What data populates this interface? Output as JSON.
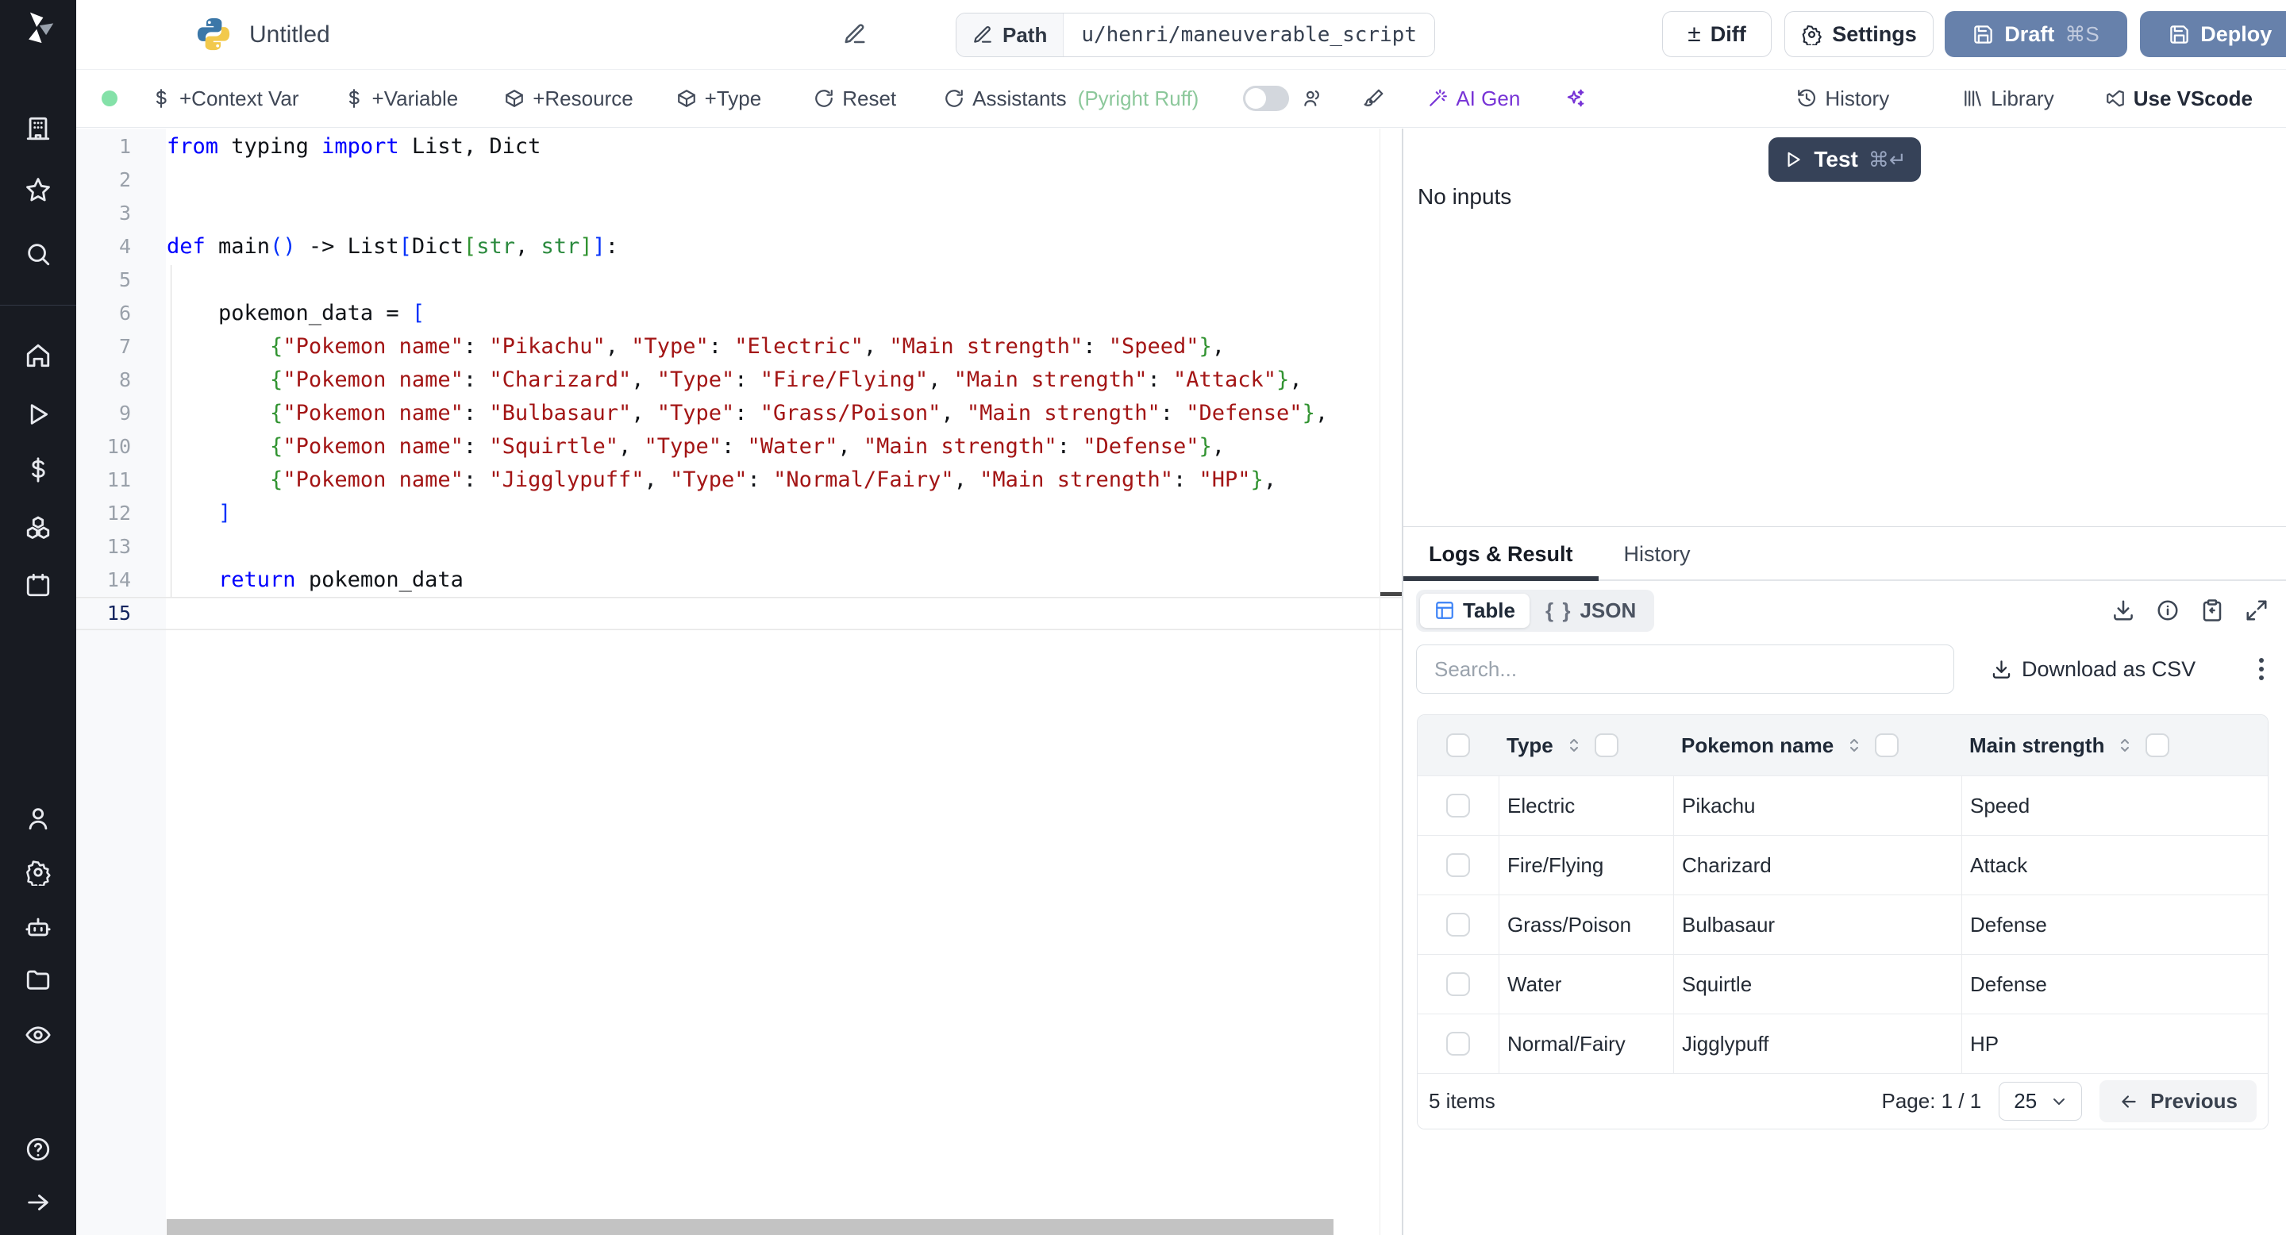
{
  "colors": {
    "slate_button": "#6781ab",
    "navy_button": "#364258",
    "ai_purple": "#7733d6",
    "status_green": "#84e1a8",
    "keyword_blue": "#0000ff",
    "string_red": "#a31515",
    "bracket_blue": "#0431fa",
    "bracket_green": "#319331",
    "type_green": "#2b8a3e"
  },
  "sidebar": {
    "icons": [
      "workspace",
      "favorites",
      "search",
      "home",
      "runs",
      "variables",
      "resources",
      "schedules",
      "users",
      "settings",
      "workers",
      "folders",
      "audit-logs",
      "help",
      "expand"
    ]
  },
  "topbar": {
    "title": "Untitled",
    "path_label": "Path",
    "path_value": "u/henri/maneuverable_script",
    "diff": "Diff",
    "diff_glyph": "±",
    "settings": "Settings",
    "draft": "Draft",
    "draft_shortcut": "⌘S",
    "deploy": "Deploy"
  },
  "toolbar": {
    "context_var": "+Context Var",
    "variable": "+Variable",
    "resource": "+Resource",
    "type": "+Type",
    "reset": "Reset",
    "assistants": "Assistants",
    "assistants_detail": "(Pyright Ruff)",
    "dollar_glyph": "$",
    "ai_gen": "AI Gen",
    "history": "History",
    "library": "Library",
    "use_vscode": "Use VScode"
  },
  "editor": {
    "language": "python",
    "lines": [
      {
        "tokens": [
          [
            "k",
            "from"
          ],
          [
            "p",
            " typing "
          ],
          [
            "k",
            "import"
          ],
          [
            "p",
            " List, Dict"
          ]
        ]
      },
      {
        "tokens": []
      },
      {
        "tokens": []
      },
      {
        "tokens": [
          [
            "k",
            "def"
          ],
          [
            "p",
            " main"
          ],
          [
            "b",
            "()"
          ],
          [
            "p",
            " -> List"
          ],
          [
            "b",
            "["
          ],
          [
            "p",
            "Dict"
          ],
          [
            "g",
            "["
          ],
          [
            "t",
            "str"
          ],
          [
            "p",
            ", "
          ],
          [
            "t",
            "str"
          ],
          [
            "g",
            "]"
          ],
          [
            "b",
            "]"
          ],
          [
            "p",
            ":"
          ]
        ]
      },
      {
        "tokens": []
      },
      {
        "tokens": [
          [
            "p",
            "    pokemon_data = "
          ],
          [
            "b",
            "["
          ]
        ]
      },
      {
        "tokens": [
          [
            "p",
            "        "
          ],
          [
            "g",
            "{"
          ],
          [
            "s",
            "\"Pokemon name\""
          ],
          [
            "p",
            ": "
          ],
          [
            "s",
            "\"Pikachu\""
          ],
          [
            "p",
            ", "
          ],
          [
            "s",
            "\"Type\""
          ],
          [
            "p",
            ": "
          ],
          [
            "s",
            "\"Electric\""
          ],
          [
            "p",
            ", "
          ],
          [
            "s",
            "\"Main strength\""
          ],
          [
            "p",
            ": "
          ],
          [
            "s",
            "\"Speed\""
          ],
          [
            "g",
            "}"
          ],
          [
            "p",
            ","
          ]
        ]
      },
      {
        "tokens": [
          [
            "p",
            "        "
          ],
          [
            "g",
            "{"
          ],
          [
            "s",
            "\"Pokemon name\""
          ],
          [
            "p",
            ": "
          ],
          [
            "s",
            "\"Charizard\""
          ],
          [
            "p",
            ", "
          ],
          [
            "s",
            "\"Type\""
          ],
          [
            "p",
            ": "
          ],
          [
            "s",
            "\"Fire/Flying\""
          ],
          [
            "p",
            ", "
          ],
          [
            "s",
            "\"Main strength\""
          ],
          [
            "p",
            ": "
          ],
          [
            "s",
            "\"Attack\""
          ],
          [
            "g",
            "}"
          ],
          [
            "p",
            ","
          ]
        ]
      },
      {
        "tokens": [
          [
            "p",
            "        "
          ],
          [
            "g",
            "{"
          ],
          [
            "s",
            "\"Pokemon name\""
          ],
          [
            "p",
            ": "
          ],
          [
            "s",
            "\"Bulbasaur\""
          ],
          [
            "p",
            ", "
          ],
          [
            "s",
            "\"Type\""
          ],
          [
            "p",
            ": "
          ],
          [
            "s",
            "\"Grass/Poison\""
          ],
          [
            "p",
            ", "
          ],
          [
            "s",
            "\"Main strength\""
          ],
          [
            "p",
            ": "
          ],
          [
            "s",
            "\"Defense\""
          ],
          [
            "g",
            "}"
          ],
          [
            "p",
            ","
          ]
        ]
      },
      {
        "tokens": [
          [
            "p",
            "        "
          ],
          [
            "g",
            "{"
          ],
          [
            "s",
            "\"Pokemon name\""
          ],
          [
            "p",
            ": "
          ],
          [
            "s",
            "\"Squirtle\""
          ],
          [
            "p",
            ", "
          ],
          [
            "s",
            "\"Type\""
          ],
          [
            "p",
            ": "
          ],
          [
            "s",
            "\"Water\""
          ],
          [
            "p",
            ", "
          ],
          [
            "s",
            "\"Main strength\""
          ],
          [
            "p",
            ": "
          ],
          [
            "s",
            "\"Defense\""
          ],
          [
            "g",
            "}"
          ],
          [
            "p",
            ","
          ]
        ]
      },
      {
        "tokens": [
          [
            "p",
            "        "
          ],
          [
            "g",
            "{"
          ],
          [
            "s",
            "\"Pokemon name\""
          ],
          [
            "p",
            ": "
          ],
          [
            "s",
            "\"Jigglypuff\""
          ],
          [
            "p",
            ", "
          ],
          [
            "s",
            "\"Type\""
          ],
          [
            "p",
            ": "
          ],
          [
            "s",
            "\"Normal/Fairy\""
          ],
          [
            "p",
            ", "
          ],
          [
            "s",
            "\"Main strength\""
          ],
          [
            "p",
            ": "
          ],
          [
            "s",
            "\"HP\""
          ],
          [
            "g",
            "}"
          ],
          [
            "p",
            ","
          ]
        ]
      },
      {
        "tokens": [
          [
            "p",
            "    "
          ],
          [
            "b",
            "]"
          ]
        ]
      },
      {
        "tokens": []
      },
      {
        "tokens": [
          [
            "p",
            "    "
          ],
          [
            "k",
            "return"
          ],
          [
            "p",
            " pokemon_data"
          ]
        ]
      },
      {
        "tokens": [],
        "current": true
      }
    ]
  },
  "right": {
    "test": "Test",
    "test_shortcut": "⌘↵",
    "no_inputs": "No inputs",
    "tabs": {
      "logs": "Logs & Result",
      "history": "History"
    },
    "view_toggle": {
      "table": "Table",
      "json": "JSON",
      "json_glyph": "{ }"
    },
    "search_placeholder": "Search...",
    "download_csv": "Download as CSV",
    "table": {
      "columns": [
        "Type",
        "Pokemon name",
        "Main strength"
      ],
      "rows": [
        [
          "Electric",
          "Pikachu",
          "Speed"
        ],
        [
          "Fire/Flying",
          "Charizard",
          "Attack"
        ],
        [
          "Grass/Poison",
          "Bulbasaur",
          "Defense"
        ],
        [
          "Water",
          "Squirtle",
          "Defense"
        ],
        [
          "Normal/Fairy",
          "Jigglypuff",
          "HP"
        ]
      ]
    },
    "footer": {
      "items": "5 items",
      "page": "Page: 1 / 1",
      "page_size": "25",
      "previous": "Previous"
    }
  }
}
